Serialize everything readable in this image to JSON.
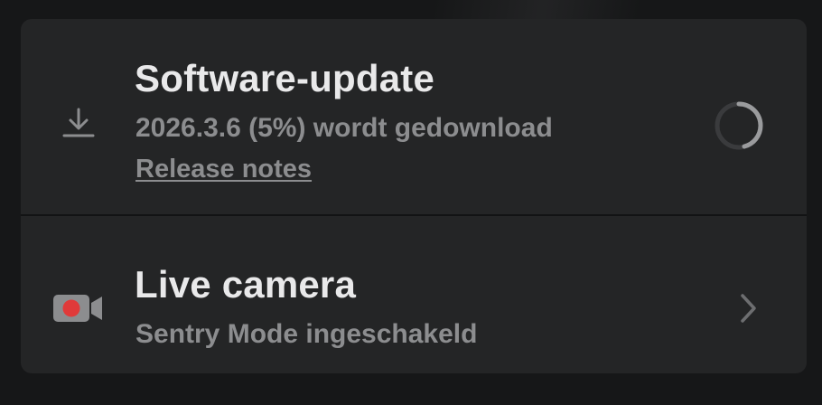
{
  "software_update": {
    "title": "Software-update",
    "status": "2026.3.6 (5%) wordt gedownload",
    "progress_percent": 5,
    "release_notes_label": "Release notes",
    "icon": "download-icon",
    "indicator": "spinner-icon"
  },
  "live_camera": {
    "title": "Live camera",
    "status": "Sentry Mode ingeschakeld",
    "icon": "camera-icon",
    "indicator": "chevron-right-icon",
    "record_color": "#e03a3a"
  }
}
